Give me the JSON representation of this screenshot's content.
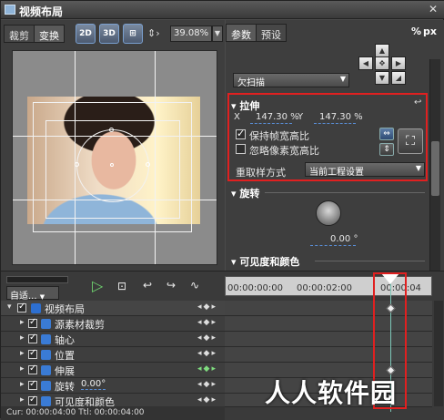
{
  "window": {
    "title": "视频布局",
    "close_label": "✕"
  },
  "left": {
    "tabs": [
      "裁剪",
      "变换"
    ],
    "btn_2d": "2D",
    "btn_3d": "3D",
    "zoom": "39.08%"
  },
  "right": {
    "tabs": [
      "参数",
      "预设"
    ],
    "unit_pct": "%",
    "unit_px": "px",
    "overscan": "欠扫描",
    "stretch": {
      "title": "拉伸",
      "x_label": "X",
      "x_value": "147.30 %",
      "y_label": "Y",
      "y_value": "147.30 %",
      "keep_ratio": "保持帧宽高比",
      "keep_ratio_checked": true,
      "ignore_pixel": "忽略像素宽高比",
      "ignore_pixel_checked": false,
      "resample_label": "重取样方式",
      "resample_value": "当前工程设置"
    },
    "rotate": {
      "title": "旋转",
      "value": "0.00 °"
    },
    "visibility": {
      "title": "可见度和颜色"
    }
  },
  "timeline": {
    "mode": "自适...",
    "tracks": [
      {
        "label": "视频布局",
        "top": true
      },
      {
        "label": "源素材裁剪"
      },
      {
        "label": "轴心"
      },
      {
        "label": "位置"
      },
      {
        "label": "伸展"
      },
      {
        "label": "旋转",
        "extra": "0.00°"
      },
      {
        "label": "可见度和颜色"
      }
    ],
    "ruler": [
      "00:00:00:00",
      "00:00:02:00",
      "00:00:04"
    ],
    "status": "Cur: 00:00:04:00  Ttl: 00:00:04:00"
  },
  "watermark": "人人软件园"
}
